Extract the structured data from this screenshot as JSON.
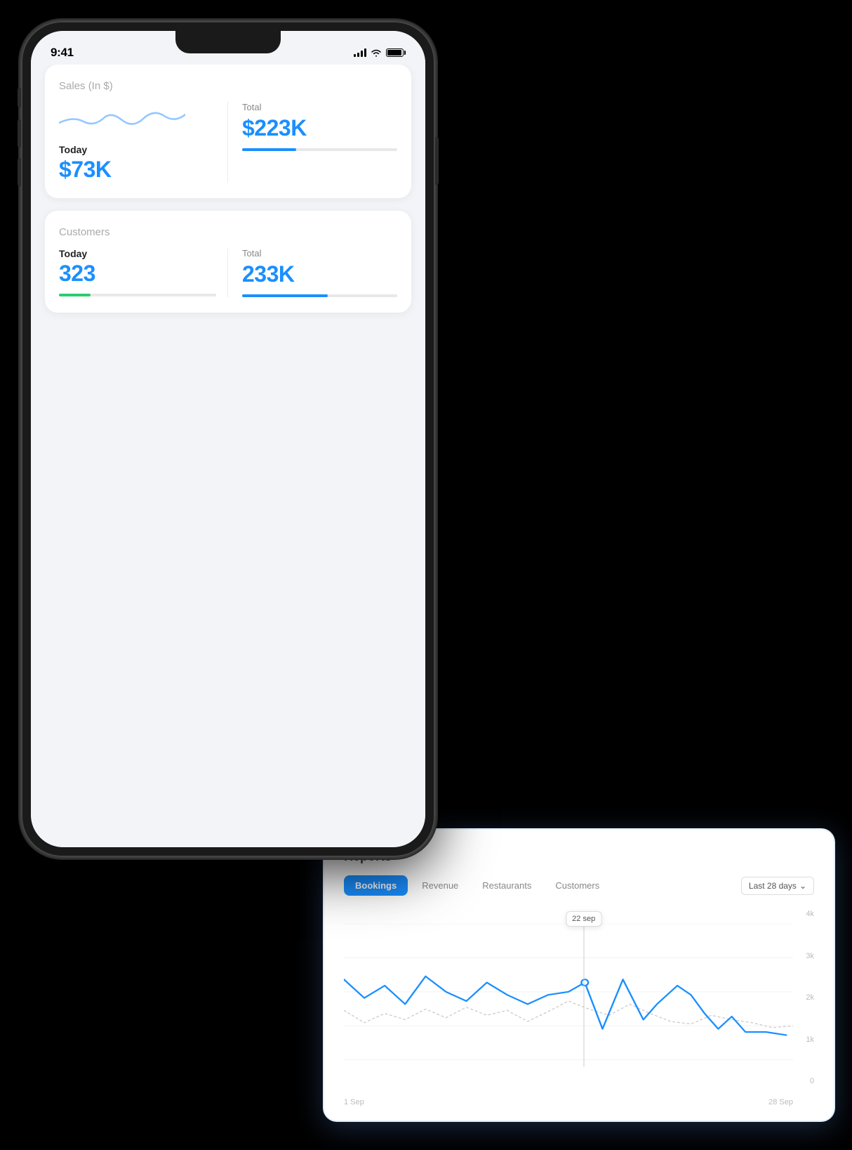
{
  "statusBar": {
    "time": "9:41"
  },
  "salesCard": {
    "title": "Sales (In $)",
    "today": {
      "label": "Today",
      "value": "$73K"
    },
    "total": {
      "label": "Total",
      "value": "$223K"
    }
  },
  "customersCard": {
    "title": "Customers",
    "today": {
      "label": "Today",
      "value": "323"
    },
    "total": {
      "label": "Total",
      "value": "233K"
    }
  },
  "reportsCard": {
    "title": "Reports",
    "tabs": [
      "Bookings",
      "Revenue",
      "Restaurants",
      "Customers"
    ],
    "activeTab": "Bookings",
    "dateFilter": "Last 28 days",
    "tooltip": "22 sep",
    "xLabels": [
      "1 Sep",
      "28 Sep"
    ],
    "yLabels": [
      "4k",
      "3k",
      "2k",
      "1k",
      "0"
    ]
  }
}
